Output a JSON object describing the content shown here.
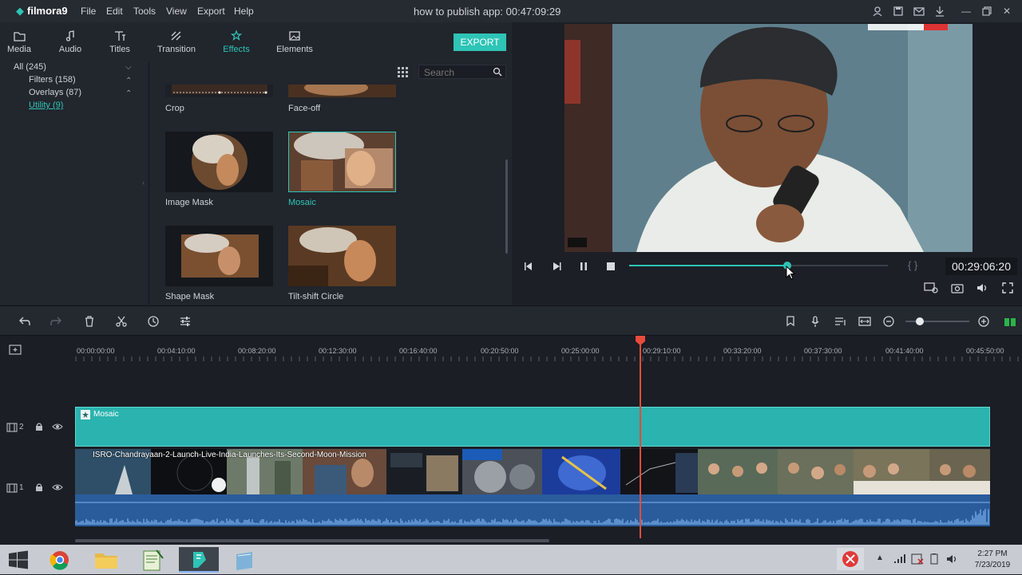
{
  "app": {
    "logo": "filmora9",
    "window_title": "how to publish app: 00:47:09:29"
  },
  "menu": [
    "File",
    "Edit",
    "Tools",
    "View",
    "Export",
    "Help"
  ],
  "nav_tabs": [
    {
      "label": "Media",
      "icon": "folder-icon"
    },
    {
      "label": "Audio",
      "icon": "music-note-icon"
    },
    {
      "label": "Titles",
      "icon": "text-icon"
    },
    {
      "label": "Transition",
      "icon": "transition-icon"
    },
    {
      "label": "Effects",
      "icon": "effects-icon",
      "active": true
    },
    {
      "label": "Elements",
      "icon": "image-icon"
    }
  ],
  "export_label": "EXPORT",
  "categories": [
    {
      "label": "All (245)"
    },
    {
      "label": "Filters (158)"
    },
    {
      "label": "Overlays (87)"
    },
    {
      "label": "Utility (9)",
      "selected": true
    }
  ],
  "search": {
    "placeholder": "Search"
  },
  "effects": [
    {
      "label": "Crop"
    },
    {
      "label": "Face-off"
    },
    {
      "label": "Image Mask"
    },
    {
      "label": "Mosaic",
      "selected": true
    },
    {
      "label": "Shape Mask"
    },
    {
      "label": "Tilt-shift Circle"
    }
  ],
  "preview": {
    "timecode": "00:29:06:20",
    "progress": 0.61,
    "brackets": "{  }"
  },
  "timeline": {
    "ruler_labels": [
      "00:00:00:00",
      "00:04:10:00",
      "00:08:20:00",
      "00:12:30:00",
      "00:16:40:00",
      "00:20:50:00",
      "00:25:00:00",
      "00:29:10:00",
      "00:33:20:00",
      "00:37:30:00",
      "00:41:40:00",
      "00:45:50:00"
    ],
    "tracks": [
      {
        "number": "2",
        "clip_label": "Mosaic"
      },
      {
        "number": "1",
        "clip_label": "ISRO-Chandrayaan-2-Launch-Live-India-Launches-Its-Second-Moon-Mission"
      }
    ]
  },
  "taskbar": {
    "time": "2:27 PM",
    "date": "7/23/2019"
  },
  "colors": {
    "accent": "#2ec4b6",
    "playhead": "#e84b3c",
    "audio_clip": "#2a5c9c"
  }
}
